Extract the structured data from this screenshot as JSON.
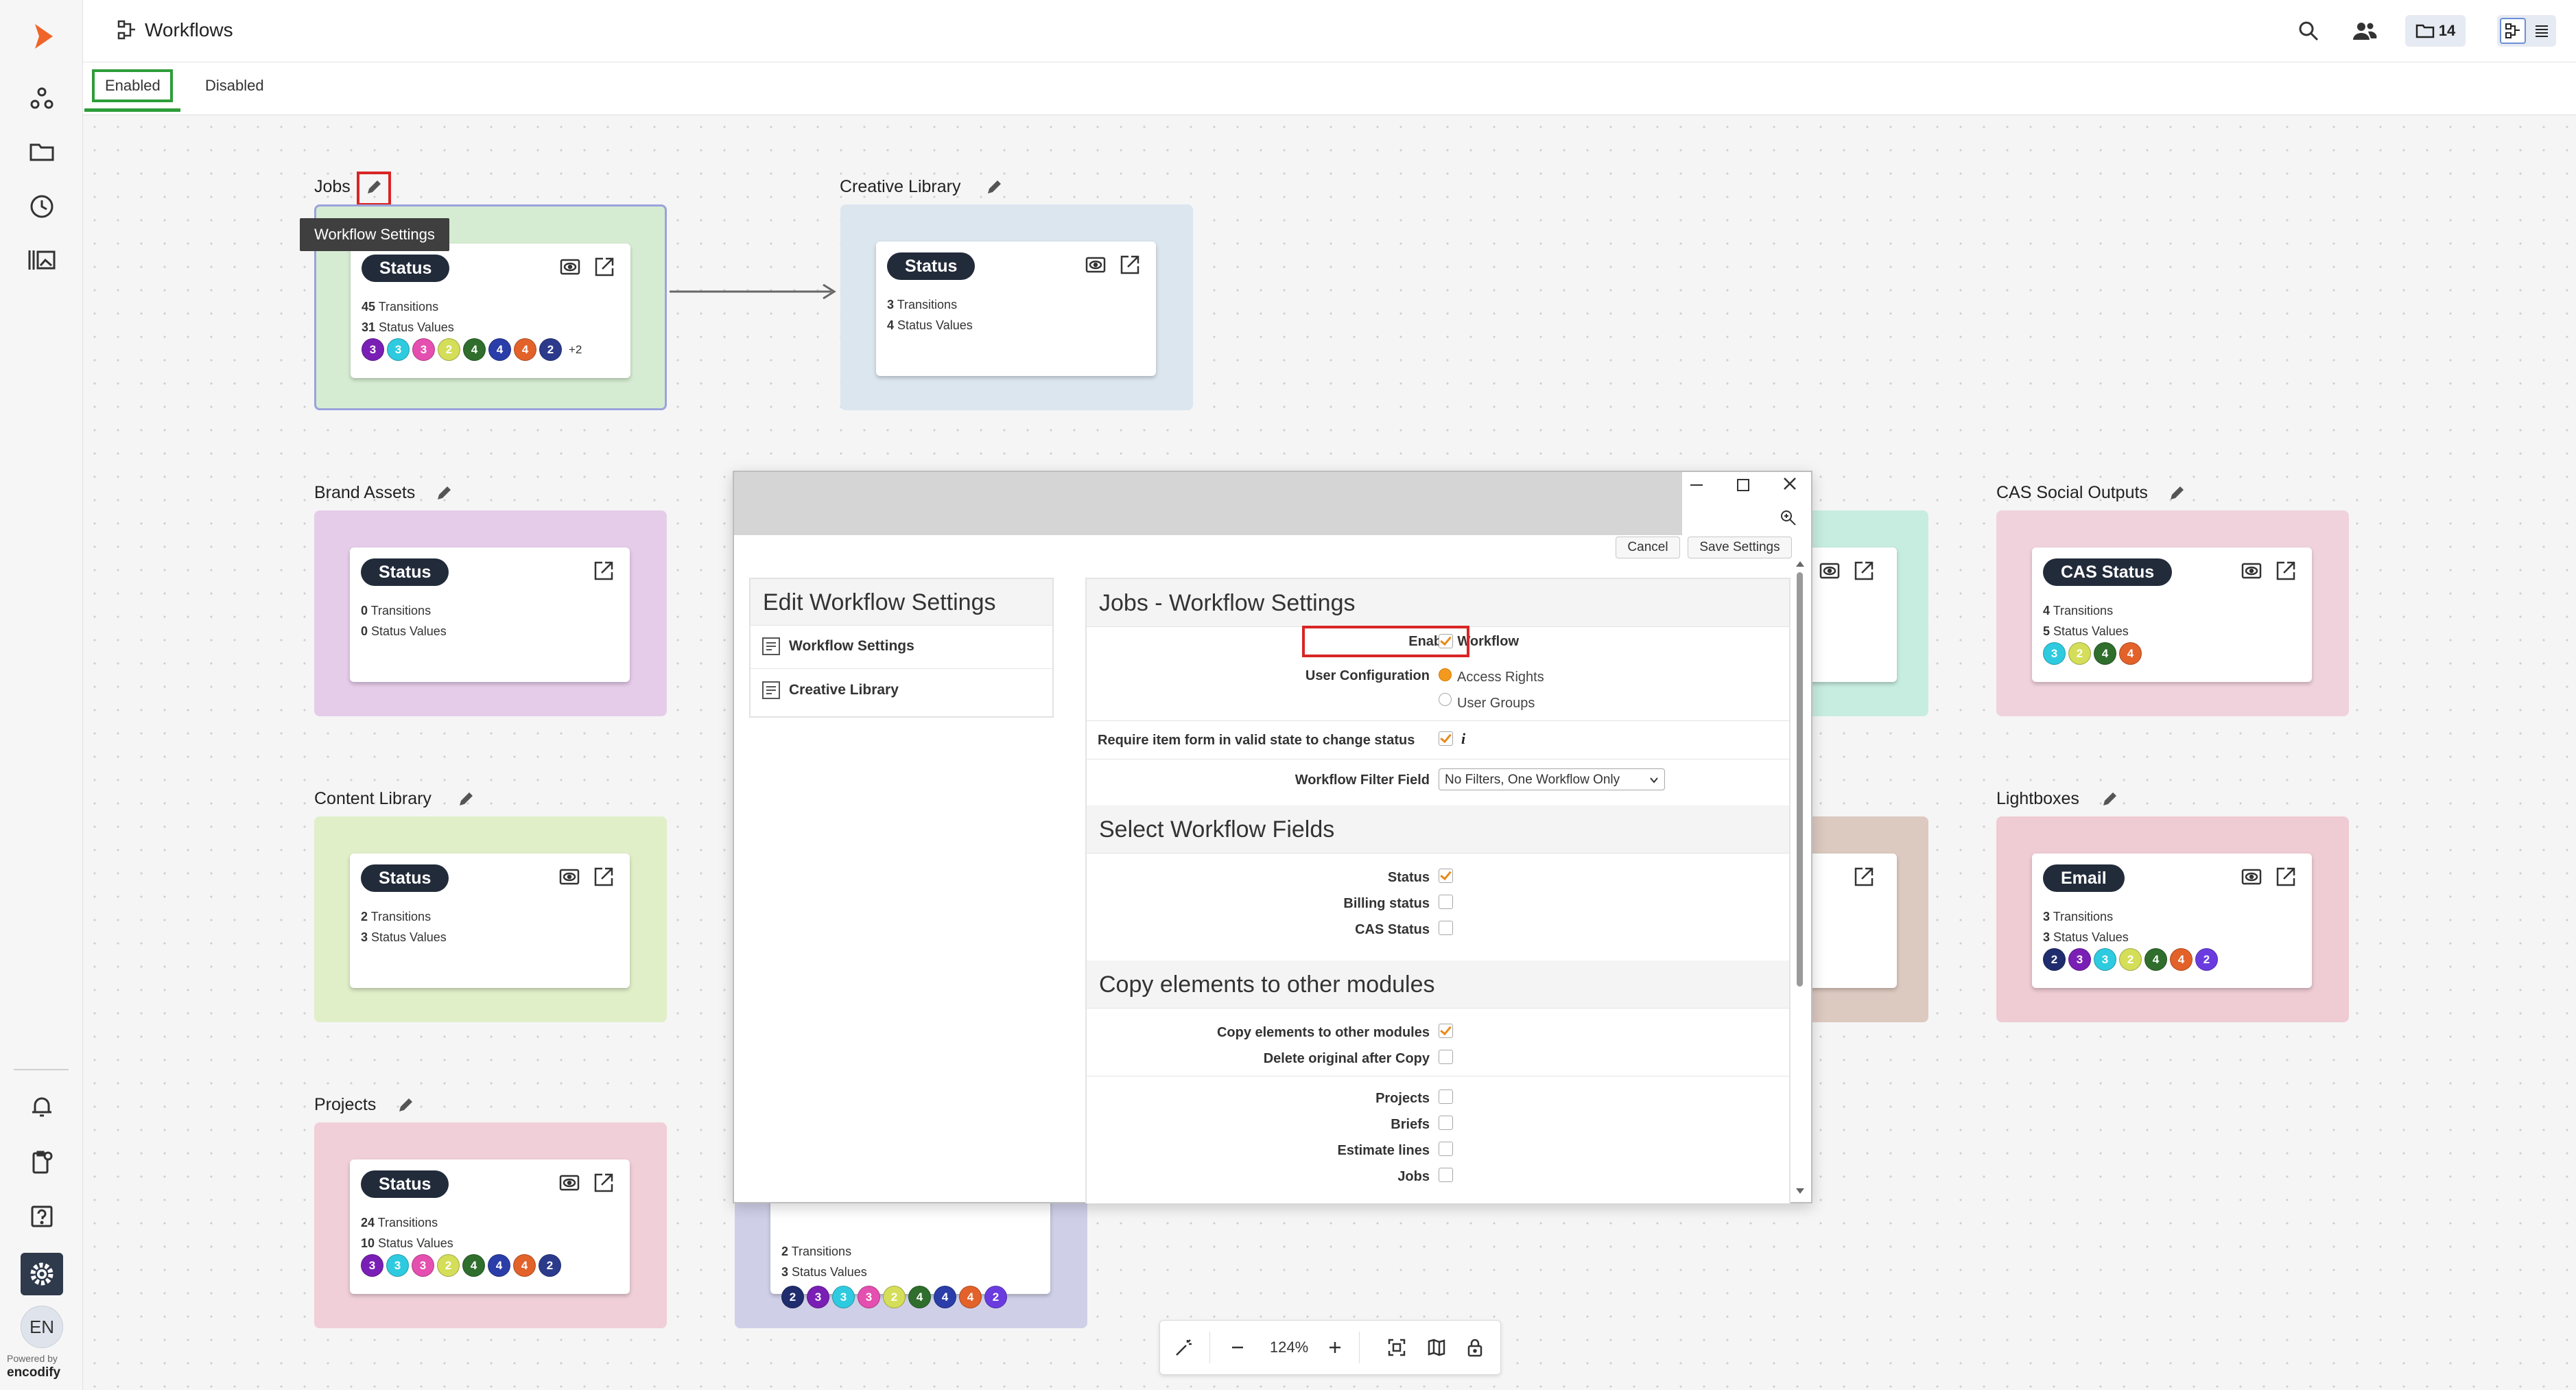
{
  "header": {
    "title": "Workflows",
    "folder_count": "14"
  },
  "tabs": {
    "enabled": "Enabled",
    "disabled": "Disabled"
  },
  "tooltip": "Workflow Settings",
  "groups": [
    {
      "id": "jobs",
      "title": "Jobs",
      "color": "#d6ecd2",
      "field": "Status",
      "transitions": "45",
      "status_values": "31",
      "chips": [
        {
          "n": "3",
          "c": "#7a1fb5"
        },
        {
          "n": "3",
          "c": "#2ecbe0"
        },
        {
          "n": "3",
          "c": "#e44fb0"
        },
        {
          "n": "2",
          "c": "#d4de58"
        },
        {
          "n": "4",
          "c": "#2f6e2c"
        },
        {
          "n": "4",
          "c": "#2a3da8"
        },
        {
          "n": "4",
          "c": "#e2622a"
        },
        {
          "n": "2",
          "c": "#2c3a8c"
        }
      ],
      "more": "+2"
    },
    {
      "id": "creative",
      "title": "Creative Library",
      "color": "#dbe6ef",
      "field": "Status",
      "transitions": "3",
      "status_values": "4",
      "chips": []
    },
    {
      "id": "brand",
      "title": "Brand Assets",
      "color": "#e5cce9",
      "field": "Status",
      "transitions": "0",
      "status_values": "0",
      "chips": []
    },
    {
      "id": "cas",
      "title": "CAS Social Outputs",
      "color": "#f0d2dc",
      "field": "CAS Status",
      "transitions": "4",
      "status_values": "5",
      "chips": [
        {
          "n": "3",
          "c": "#2ecbe0"
        },
        {
          "n": "2",
          "c": "#d4de58"
        },
        {
          "n": "4",
          "c": "#2f6e2c"
        },
        {
          "n": "4",
          "c": "#e2622a"
        }
      ]
    },
    {
      "id": "content",
      "title": "Content Library",
      "color": "#e0efc8",
      "field": "Status",
      "transitions": "2",
      "status_values": "3",
      "chips": []
    },
    {
      "id": "lightboxes",
      "title": "Lightboxes",
      "color": "#efcbd3",
      "field": "Email",
      "transitions": "3",
      "status_values": "3",
      "chips": [
        {
          "n": "2",
          "c": "#1f2d6e"
        },
        {
          "n": "3",
          "c": "#7a1fb5"
        },
        {
          "n": "3",
          "c": "#2ecbe0"
        },
        {
          "n": "2",
          "c": "#d4de58"
        },
        {
          "n": "4",
          "c": "#2f6e2c"
        },
        {
          "n": "4",
          "c": "#e2622a"
        },
        {
          "n": "2",
          "c": "#6a3ce0"
        }
      ]
    },
    {
      "id": "projects",
      "title": "Projects",
      "color": "#f0cfd8",
      "field": "Status",
      "transitions": "24",
      "status_values": "10",
      "chips": [
        {
          "n": "3",
          "c": "#7a1fb5"
        },
        {
          "n": "3",
          "c": "#2ecbe0"
        },
        {
          "n": "3",
          "c": "#e44fb0"
        },
        {
          "n": "2",
          "c": "#d4de58"
        },
        {
          "n": "4",
          "c": "#2f6e2c"
        },
        {
          "n": "4",
          "c": "#2a3da8"
        },
        {
          "n": "4",
          "c": "#e2622a"
        },
        {
          "n": "2",
          "c": "#2c3a8c"
        }
      ]
    },
    {
      "id": "partial",
      "title": "",
      "color": "#cfd0e8",
      "field": "",
      "transitions": "2",
      "status_values": "3",
      "chips": [
        {
          "n": "2",
          "c": "#1f2d6e"
        },
        {
          "n": "3",
          "c": "#7a1fb5"
        },
        {
          "n": "3",
          "c": "#2ecbe0"
        },
        {
          "n": "3",
          "c": "#e44fb0"
        },
        {
          "n": "2",
          "c": "#d4de58"
        },
        {
          "n": "4",
          "c": "#2f6e2c"
        },
        {
          "n": "4",
          "c": "#2a3da8"
        },
        {
          "n": "4",
          "c": "#e2622a"
        },
        {
          "n": "2",
          "c": "#6a3ce0"
        }
      ]
    }
  ],
  "labels": {
    "transitions": "Transitions",
    "status_values": "Status Values"
  },
  "modal": {
    "cancel": "Cancel",
    "save": "Save Settings",
    "side_title": "Edit Workflow Settings",
    "side_items": [
      "Workflow Settings",
      "Creative Library"
    ],
    "main_title": "Jobs - Workflow Settings",
    "enable_workflow": "Enable Workflow",
    "user_configuration": "User Configuration",
    "access_rights": "Access Rights",
    "user_groups": "User Groups",
    "require_valid": "Require item form in valid state to change status",
    "filter_field": "Workflow Filter Field",
    "filter_value": "No Filters, One Workflow Only",
    "select_fields_title": "Select Workflow Fields",
    "fields": [
      "Status",
      "Billing status",
      "CAS Status"
    ],
    "copy_title": "Copy elements to other modules",
    "copy_elements": "Copy elements to other modules",
    "delete_original": "Delete original after Copy",
    "modules": [
      "Projects",
      "Briefs",
      "Estimate lines",
      "Jobs"
    ]
  },
  "zoom": {
    "level": "124%"
  },
  "footer": {
    "avatar": "EN",
    "powered": "Powered by",
    "brand": "encodify"
  },
  "colors": {
    "accent": "#f0642a",
    "active_tab_border": "#2e9d3a",
    "highlight": "#d92525"
  }
}
